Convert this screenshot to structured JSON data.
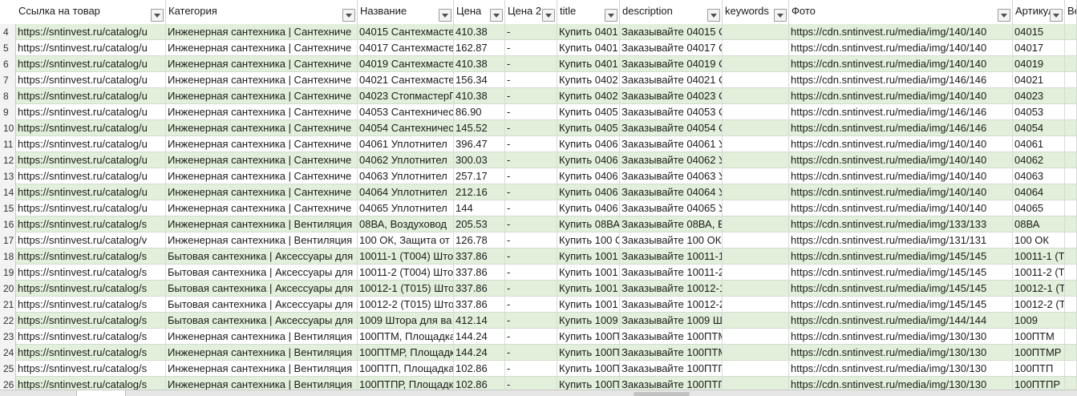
{
  "columns": [
    {
      "label": "Ссылка на товар",
      "name": "col-link"
    },
    {
      "label": "Категория",
      "name": "col-category"
    },
    {
      "label": "Название",
      "name": "col-name"
    },
    {
      "label": "Цена",
      "name": "col-price"
    },
    {
      "label": "Цена 2",
      "name": "col-price2"
    },
    {
      "label": "title",
      "name": "col-title"
    },
    {
      "label": "description",
      "name": "col-description"
    },
    {
      "label": "keywords",
      "name": "col-keywords"
    },
    {
      "label": "Фото",
      "name": "col-photo"
    },
    {
      "label": "Артикул",
      "name": "col-article"
    },
    {
      "label": "Вес",
      "name": "col-weight"
    }
  ],
  "rows": [
    {
      "n": "4",
      "cells": [
        "https://sntinvest.ru/catalog/u",
        "Инженерная сантехника | Сантехниче",
        "04015 Сантехмасте",
        "410.38",
        "-",
        "Купить 0401",
        "Заказывайте 04015 С",
        "",
        "https://cdn.sntinvest.ru/media/img/140/140",
        "04015",
        ""
      ]
    },
    {
      "n": "5",
      "cells": [
        "https://sntinvest.ru/catalog/u",
        "Инженерная сантехника | Сантехниче",
        "04017 Сантехмасте",
        "162.87",
        "-",
        "Купить 0401",
        "Заказывайте 04017 С",
        "",
        "https://cdn.sntinvest.ru/media/img/140/140",
        "04017",
        ""
      ]
    },
    {
      "n": "6",
      "cells": [
        "https://sntinvest.ru/catalog/u",
        "Инженерная сантехника | Сантехниче",
        "04019 Сантехмасте",
        "410.38",
        "-",
        "Купить 0401",
        "Заказывайте 04019 С",
        "",
        "https://cdn.sntinvest.ru/media/img/140/140",
        "04019",
        ""
      ]
    },
    {
      "n": "7",
      "cells": [
        "https://sntinvest.ru/catalog/u",
        "Инженерная сантехника | Сантехниче",
        "04021 Сантехмасте",
        "156.34",
        "-",
        "Купить 0402",
        "Заказывайте 04021 С",
        "",
        "https://cdn.sntinvest.ru/media/img/146/146",
        "04021",
        ""
      ]
    },
    {
      "n": "8",
      "cells": [
        "https://sntinvest.ru/catalog/u",
        "Инженерная сантехника | Сантехниче",
        "04023 СтопмастерГ",
        "410.38",
        "-",
        "Купить 0402",
        "Заказывайте 04023 С",
        "",
        "https://cdn.sntinvest.ru/media/img/140/140",
        "04023",
        ""
      ]
    },
    {
      "n": "9",
      "cells": [
        "https://sntinvest.ru/catalog/u",
        "Инженерная сантехника | Сантехниче",
        "04053 Сантехничес",
        "86.90",
        "-",
        "Купить 0405",
        "Заказывайте 04053 С",
        "",
        "https://cdn.sntinvest.ru/media/img/146/146",
        "04053",
        ""
      ]
    },
    {
      "n": "10",
      "cells": [
        "https://sntinvest.ru/catalog/u",
        "Инженерная сантехника | Сантехниче",
        "04054 Сантехничес",
        "145.52",
        "-",
        "Купить 0405",
        "Заказывайте 04054 С",
        "",
        "https://cdn.sntinvest.ru/media/img/146/146",
        "04054",
        ""
      ]
    },
    {
      "n": "11",
      "cells": [
        "https://sntinvest.ru/catalog/u",
        "Инженерная сантехника | Сантехниче",
        "04061 Уплотнител",
        "396.47",
        "-",
        "Купить 0406",
        "Заказывайте 04061 У",
        "",
        "https://cdn.sntinvest.ru/media/img/140/140",
        "04061",
        ""
      ]
    },
    {
      "n": "12",
      "cells": [
        "https://sntinvest.ru/catalog/u",
        "Инженерная сантехника | Сантехниче",
        "04062 Уплотнител",
        "300.03",
        "-",
        "Купить 0406",
        "Заказывайте 04062 У",
        "",
        "https://cdn.sntinvest.ru/media/img/140/140",
        "04062",
        ""
      ]
    },
    {
      "n": "13",
      "cells": [
        "https://sntinvest.ru/catalog/u",
        "Инженерная сантехника | Сантехниче",
        "04063 Уплотнител",
        "257.17",
        "-",
        "Купить 0406",
        "Заказывайте 04063 У",
        "",
        "https://cdn.sntinvest.ru/media/img/140/140",
        "04063",
        ""
      ]
    },
    {
      "n": "14",
      "cells": [
        "https://sntinvest.ru/catalog/u",
        "Инженерная сантехника | Сантехниче",
        "04064 Уплотнител",
        "212.16",
        "-",
        "Купить 0406",
        "Заказывайте 04064 У",
        "",
        "https://cdn.sntinvest.ru/media/img/140/140",
        "04064",
        ""
      ]
    },
    {
      "n": "15",
      "cells": [
        "https://sntinvest.ru/catalog/u",
        "Инженерная сантехника | Сантехниче",
        "04065 Уплотнител",
        "144",
        "-",
        "Купить 0406",
        "Заказывайте 04065 У",
        "",
        "https://cdn.sntinvest.ru/media/img/140/140",
        "04065",
        ""
      ]
    },
    {
      "n": "16",
      "cells": [
        "https://sntinvest.ru/catalog/s",
        "Инженерная сантехника | Вентиляция",
        "08ВА, Воздуховод",
        "205.53",
        "-",
        "Купить 08ВА",
        "Заказывайте 08ВА, В",
        "",
        "https://cdn.sntinvest.ru/media/img/133/133",
        "08ВА",
        ""
      ]
    },
    {
      "n": "17",
      "cells": [
        "https://sntinvest.ru/catalog/v",
        "Инженерная сантехника | Вентиляция",
        "100 ОК, Защита от",
        "126.78",
        "-",
        "Купить 100 О",
        "Заказывайте 100 ОК",
        "",
        "https://cdn.sntinvest.ru/media/img/131/131",
        "100 ОК",
        ""
      ]
    },
    {
      "n": "18",
      "cells": [
        "https://sntinvest.ru/catalog/s",
        "Бытовая сантехника | Аксессуары для",
        "10011-1 (Т004) Што",
        "337.86",
        "-",
        "Купить 1001",
        "Заказывайте 10011-1",
        "",
        "https://cdn.sntinvest.ru/media/img/145/145",
        "10011-1 (Т",
        ""
      ]
    },
    {
      "n": "19",
      "cells": [
        "https://sntinvest.ru/catalog/s",
        "Бытовая сантехника | Аксессуары для",
        "10011-2 (Т004) Што",
        "337.86",
        "-",
        "Купить 1001",
        "Заказывайте 10011-2",
        "",
        "https://cdn.sntinvest.ru/media/img/145/145",
        "10011-2 (Т",
        ""
      ]
    },
    {
      "n": "20",
      "cells": [
        "https://sntinvest.ru/catalog/s",
        "Бытовая сантехника | Аксессуары для",
        "10012-1 (Т015) Што",
        "337.86",
        "-",
        "Купить 1001",
        "Заказывайте 10012-1",
        "",
        "https://cdn.sntinvest.ru/media/img/145/145",
        "10012-1 (Т",
        ""
      ]
    },
    {
      "n": "21",
      "cells": [
        "https://sntinvest.ru/catalog/s",
        "Бытовая сантехника | Аксессуары для",
        "10012-2 (Т015) Што",
        "337.86",
        "-",
        "Купить 1001",
        "Заказывайте 10012-2",
        "",
        "https://cdn.sntinvest.ru/media/img/145/145",
        "10012-2 (Т",
        ""
      ]
    },
    {
      "n": "22",
      "cells": [
        "https://sntinvest.ru/catalog/s",
        "Бытовая сантехника | Аксессуары для",
        "1009 Штора для ва",
        "412.14",
        "-",
        "Купить 1009",
        "Заказывайте 1009 Ш",
        "",
        "https://cdn.sntinvest.ru/media/img/144/144",
        "1009",
        ""
      ]
    },
    {
      "n": "23",
      "cells": [
        "https://sntinvest.ru/catalog/s",
        "Инженерная сантехника | Вентиляция",
        "100ПТМ, Площадка",
        "144.24",
        "-",
        "Купить 100П",
        "Заказывайте 100ПТМ",
        "",
        "https://cdn.sntinvest.ru/media/img/130/130",
        "100ПТМ",
        ""
      ]
    },
    {
      "n": "24",
      "cells": [
        "https://sntinvest.ru/catalog/s",
        "Инженерная сантехника | Вентиляция",
        "100ПТМР, Площадк",
        "144.24",
        "-",
        "Купить 100П",
        "Заказывайте 100ПТМ",
        "",
        "https://cdn.sntinvest.ru/media/img/130/130",
        "100ПТМР",
        ""
      ]
    },
    {
      "n": "25",
      "cells": [
        "https://sntinvest.ru/catalog/s",
        "Инженерная сантехника | Вентиляция",
        "100ПТП, Площадка",
        "102.86",
        "-",
        "Купить 100П",
        "Заказывайте 100ПТП",
        "",
        "https://cdn.sntinvest.ru/media/img/130/130",
        "100ПТП",
        ""
      ]
    },
    {
      "n": "26",
      "cells": [
        "https://sntinvest.ru/catalog/s",
        "Инженерная сантехника | Вентиляция",
        "100ПТПР, Площадк",
        "102.86",
        "-",
        "Купить 100П",
        "Заказывайте 100ПТП",
        "",
        "https://cdn.sntinvest.ru/media/img/130/130",
        "100ПТПР",
        ""
      ]
    }
  ]
}
